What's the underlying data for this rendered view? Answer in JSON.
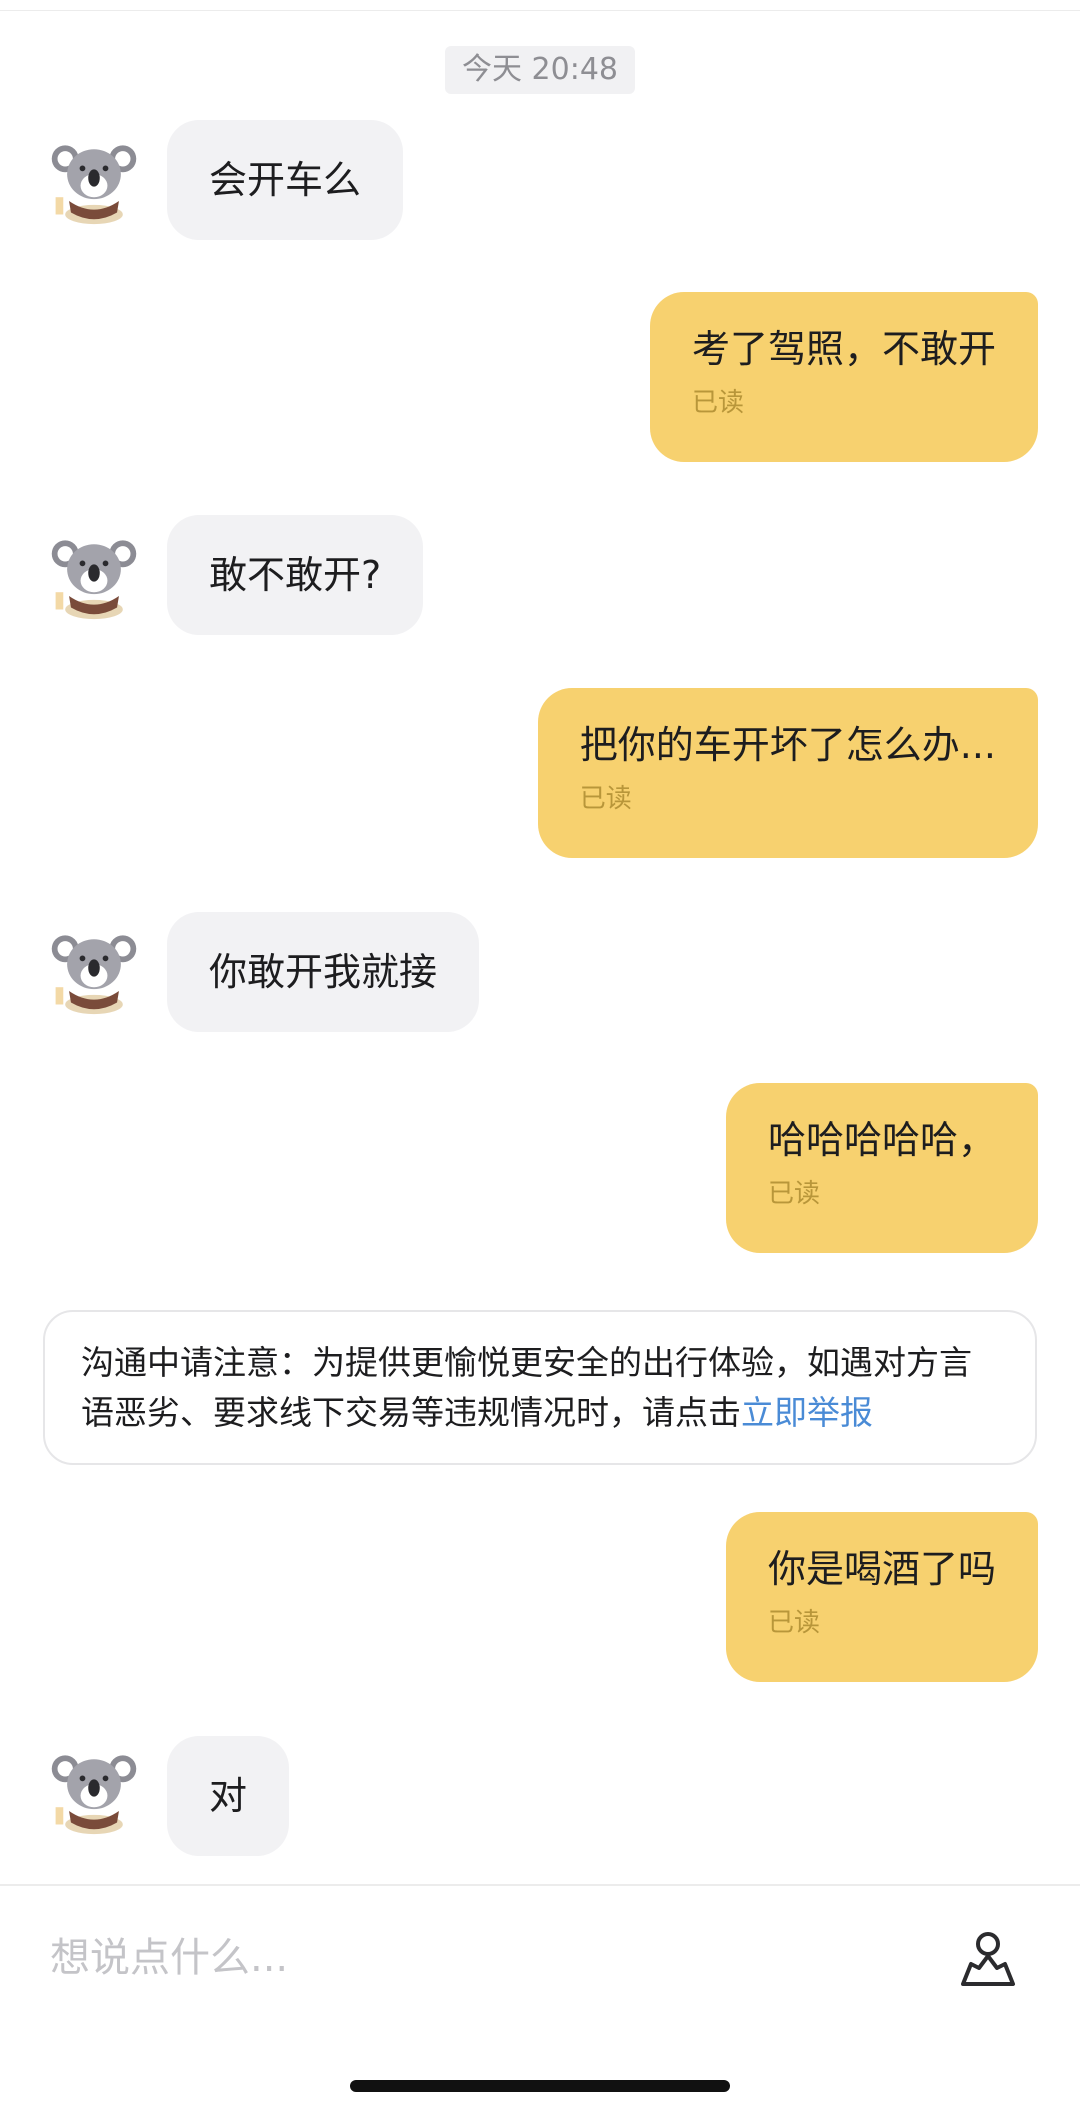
{
  "timestamp": "今天 20:48",
  "messages": [
    {
      "side": "left",
      "text": "会开车么"
    },
    {
      "side": "right",
      "text": "考了驾照，不敢开",
      "read": "已读"
    },
    {
      "side": "left",
      "text": "敢不敢开?"
    },
    {
      "side": "right",
      "text": "把你的车开坏了怎么办...",
      "read": "已读"
    },
    {
      "side": "left",
      "text": "你敢开我就接"
    },
    {
      "side": "right",
      "text": "哈哈哈哈哈，",
      "read": "已读"
    },
    {
      "side": "right",
      "text": "你是喝酒了吗",
      "read": "已读"
    },
    {
      "side": "left",
      "text": "对"
    }
  ],
  "notice": {
    "text": "沟通中请注意：为提供更愉悦更安全的出行体验，如遇对方言语恶劣、要求线下交易等违规情况时，请点击",
    "link": "立即举报"
  },
  "input": {
    "placeholder": "想说点什么..."
  },
  "icons": {
    "avatar": "koala-avatar-icon",
    "location": "location-share-icon"
  },
  "colors": {
    "sent_bubble": "#f7d16f",
    "received_bubble": "#f2f2f4",
    "link": "#4a8bd6"
  }
}
